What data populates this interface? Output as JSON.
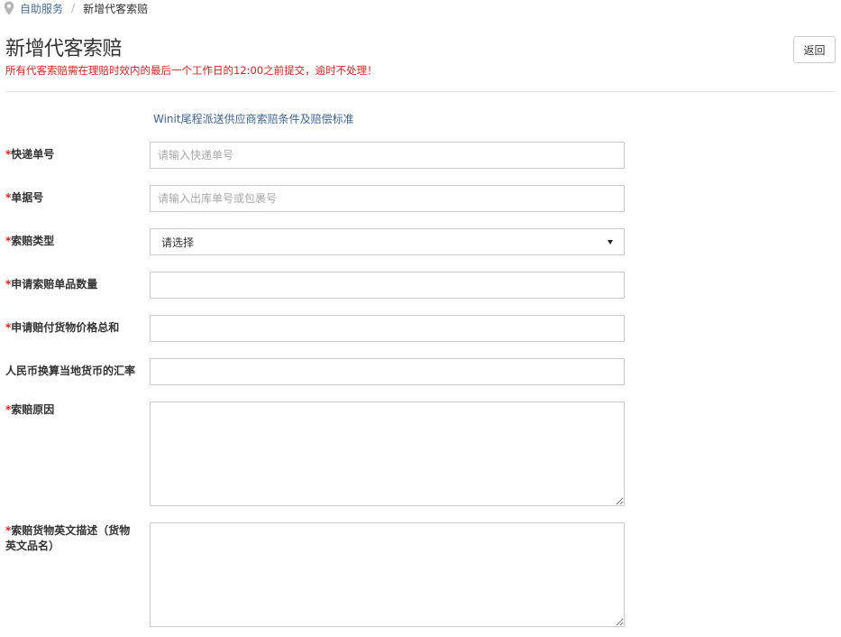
{
  "breadcrumb": {
    "icon": "map-pin-icon",
    "parent": "自助服务",
    "separator": "/",
    "current": "新增代客索赔"
  },
  "header": {
    "title": "新增代客索赔",
    "warning": "所有代客索赔需在理赔时效内的最后一个工作日的12:00之前提交，逾时不处理！",
    "back_label": "返回"
  },
  "standard_link": "Winit尾程派送供应商索赔条件及赔偿标准",
  "form": {
    "required_mark": "*",
    "tracking_number": {
      "label": "快递单号",
      "placeholder": "请输入快递单号",
      "value": ""
    },
    "document_number": {
      "label": "单据号",
      "placeholder": "请输入出库单号或包裹号",
      "value": ""
    },
    "claim_type": {
      "label": "索赔类型",
      "selected": "请选择"
    },
    "item_quantity": {
      "label": "申请索赔单品数量",
      "value": ""
    },
    "total_price": {
      "label": "申请赔付货物价格总和",
      "value": ""
    },
    "exchange_rate": {
      "label": "人民币换算当地货币的汇率",
      "value": ""
    },
    "claim_reason": {
      "label": "索赔原因",
      "value": ""
    },
    "english_description": {
      "label": "索赔货物英文描述（货物英文品名）",
      "value": ""
    }
  },
  "colors": {
    "required": "#e02020",
    "link": "#3f6494",
    "border": "#cccccc"
  }
}
